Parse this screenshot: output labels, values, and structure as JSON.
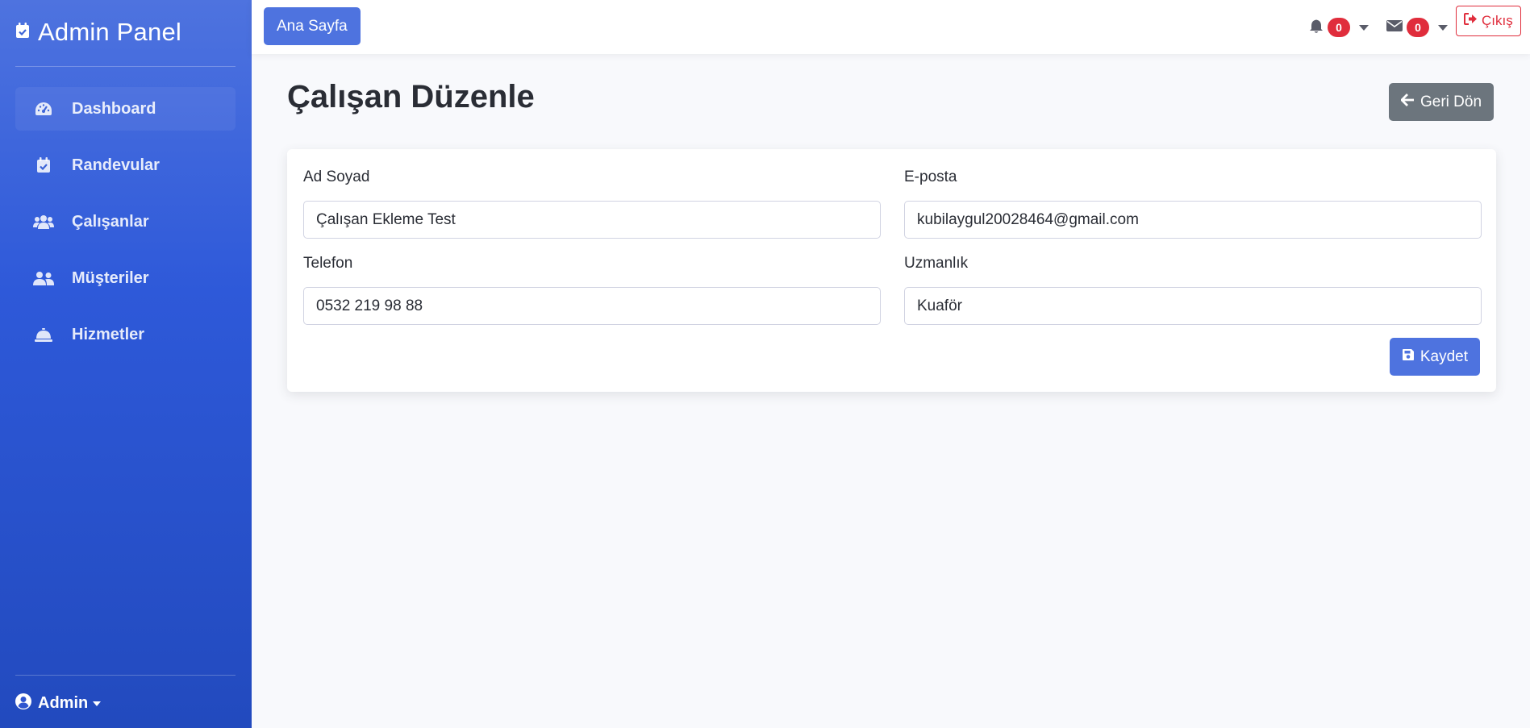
{
  "sidebar": {
    "brand": {
      "title": "Admin Panel",
      "icon": "calendar-check-icon"
    },
    "items": [
      {
        "label": "Dashboard",
        "icon": "tachometer-icon"
      },
      {
        "label": "Randevular",
        "icon": "calendar-check-icon"
      },
      {
        "label": "Çalışanlar",
        "icon": "users-icon"
      },
      {
        "label": "Müşteriler",
        "icon": "user-friends-icon"
      },
      {
        "label": "Hizmetler",
        "icon": "concierge-bell-icon"
      }
    ],
    "user": {
      "name": "Admin",
      "icon": "user-circle-icon"
    }
  },
  "topbar": {
    "home_button": "Ana Sayfa",
    "alerts_count": "0",
    "messages_count": "0",
    "logout_label": "Çıkış"
  },
  "page": {
    "title": "Çalışan Düzenle",
    "back_button": "Geri Dön"
  },
  "form": {
    "name_label": "Ad Soyad",
    "name_value": "Çalışan Ekleme Test",
    "email_label": "E-posta",
    "email_value": "kubilaygul20028464@gmail.com",
    "phone_label": "Telefon",
    "phone_value": "0532 219 98 88",
    "specialty_label": "Uzmanlık",
    "specialty_value": "Kuaför",
    "save_button": "Kaydet"
  },
  "colors": {
    "primary": "#4e73df",
    "secondary": "#6c757d",
    "danger": "#e02d3c",
    "background": "#f8f9fc"
  }
}
